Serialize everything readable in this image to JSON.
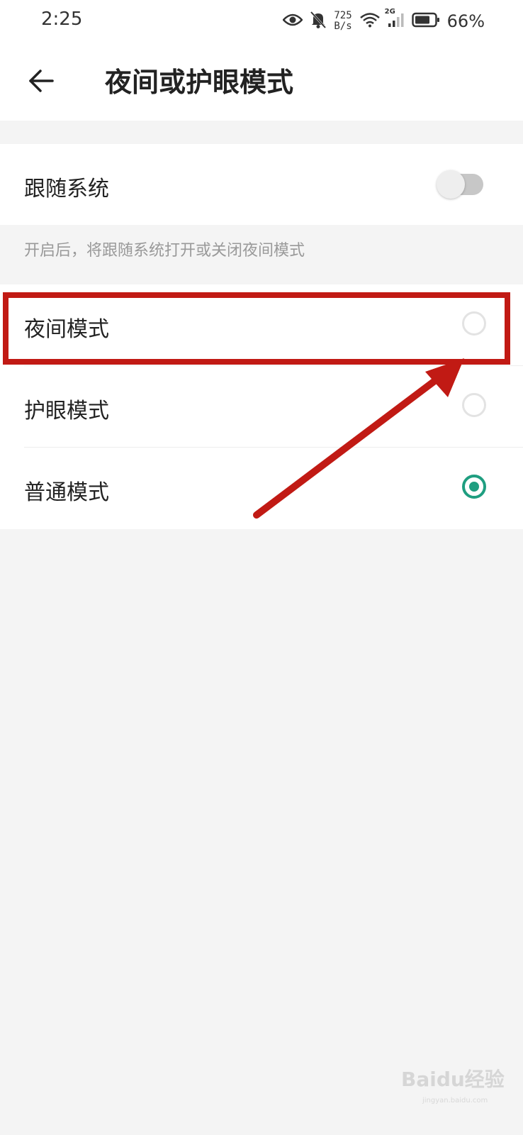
{
  "status_bar": {
    "time": "2:25",
    "speed_value": "725",
    "speed_unit": "B/s",
    "network": "2G",
    "battery_percent": "66%",
    "icons": [
      "eye-icon",
      "bell-off-icon",
      "wifi-icon",
      "signal-icon",
      "battery-icon"
    ]
  },
  "header": {
    "title": "夜间或护眼模式",
    "back_icon": "arrow-left-icon"
  },
  "follow_system": {
    "label": "跟随系统",
    "enabled": false,
    "hint": "开启后，将跟随系统打开或关闭夜间模式"
  },
  "modes": [
    {
      "label": "夜间模式",
      "selected": false
    },
    {
      "label": "护眼模式",
      "selected": false
    },
    {
      "label": "普通模式",
      "selected": true
    }
  ],
  "colors": {
    "accent": "#1f9e80",
    "annotation": "#c11a14",
    "background": "#f4f4f4"
  },
  "watermark": {
    "brand": "Baidu经验",
    "url": "jingyan.baidu.com"
  }
}
